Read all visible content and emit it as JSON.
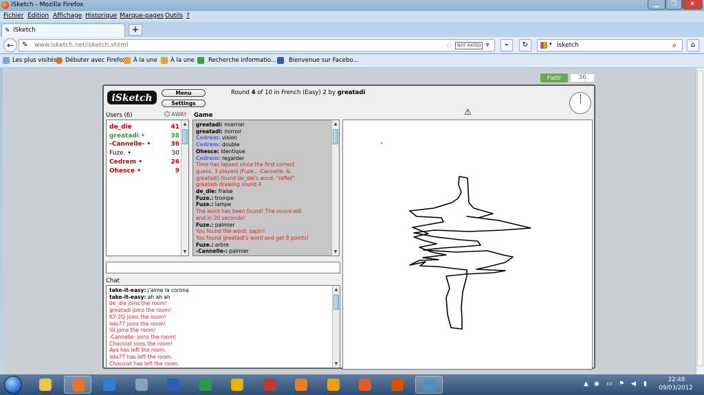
{
  "window": {
    "title": "iSketch - Mozilla Firefox"
  },
  "menu": [
    "Fichier",
    "Édition",
    "Affichage",
    "Historique",
    "Marque-pages",
    "Outils",
    "?"
  ],
  "tab": {
    "label": "iSketch"
  },
  "new_tab": "+",
  "address": {
    "url": "www.isketch.net/isketch.shtml",
    "rating": "NOT RATED"
  },
  "search": {
    "engine_icon": "google-icon",
    "value": "isketch"
  },
  "bookmarks": [
    "Les plus visités",
    "Débuter avec Firefox",
    "À la une",
    "À la une",
    "Recherche informatio...",
    "Bienvenue sur Facebo..."
  ],
  "flattr": {
    "label": "Flattr",
    "count": "36"
  },
  "app": {
    "logo": "iSketch",
    "menu_button": "Menu",
    "settings_button": "Settings",
    "round": {
      "prefix": "Round",
      "current": "4",
      "of": "of",
      "total": "10",
      "mode": "in French (Easy) 2 by",
      "drawer": "greatadi"
    },
    "users_header": "Users (6)",
    "away_label": "AWAY",
    "game_header": "Game",
    "chat_header": "Chat",
    "users": [
      {
        "name": "de_die",
        "score": "41",
        "color": "#cc0000"
      },
      {
        "name": "greatadi •",
        "score": "38",
        "color": "#22aa22"
      },
      {
        "name": "-Cannelle- •",
        "score": "36",
        "color": "#cc0000"
      },
      {
        "name": "Fuze. •",
        "score": "30",
        "color": "#000000"
      },
      {
        "name": "Cedrem •",
        "score": "26",
        "color": "#cc0000"
      },
      {
        "name": "Ohesce •",
        "score": "9",
        "color": "#cc0000"
      }
    ],
    "game_log": [
      {
        "user": "greatadi:",
        "text": " mierroir",
        "color": "#000000",
        "ucolor": "#000000"
      },
      {
        "user": "greatadi:",
        "text": " mirroir",
        "color": "#000000",
        "ucolor": "#000000"
      },
      {
        "user": "Cedrem:",
        "text": " vision",
        "color": "#000000",
        "ucolor": "#5566ee"
      },
      {
        "user": "Cedrem:",
        "text": " double",
        "color": "#000000",
        "ucolor": "#5566ee"
      },
      {
        "user": "Ohesce:",
        "text": " identique",
        "color": "#000000",
        "ucolor": "#000000"
      },
      {
        "user": "Cedrem:",
        "text": " regarder",
        "color": "#000000",
        "ucolor": "#5566ee"
      },
      {
        "user": "",
        "text": "Time has lapsed since the first correct",
        "color": "#dd2222",
        "ucolor": "#dd2222"
      },
      {
        "user": "",
        "text": "guess. 3 players (Fuze., -Cannelle- &",
        "color": "#dd2222",
        "ucolor": "#dd2222"
      },
      {
        "user": "",
        "text": "greatadi) found de_die's word: \"reflet\"",
        "color": "#dd2222",
        "ucolor": "#dd2222"
      },
      {
        "user": "",
        "text": "greatadi drawing round 4",
        "color": "#dd2222",
        "ucolor": "#dd2222"
      },
      {
        "user": "de_die:",
        "text": " fraise",
        "color": "#000000",
        "ucolor": "#000000"
      },
      {
        "user": "Fuze.:",
        "text": " trompe",
        "color": "#000000",
        "ucolor": "#000000"
      },
      {
        "user": "Fuze.:",
        "text": " lampe",
        "color": "#000000",
        "ucolor": "#000000"
      },
      {
        "user": "",
        "text": "The word has been found! The round will",
        "color": "#dd2222",
        "ucolor": "#dd2222"
      },
      {
        "user": "",
        "text": "end in 20 seconds!",
        "color": "#dd2222",
        "ucolor": "#dd2222"
      },
      {
        "user": "Fuze.:",
        "text": " palmier",
        "color": "#000000",
        "ucolor": "#000000"
      },
      {
        "user": "",
        "text": "You found the word: sapin!",
        "color": "#dd2222",
        "ucolor": "#dd2222"
      },
      {
        "user": "",
        "text": "You found greatadi's word and get 8 points!",
        "color": "#dd2222",
        "ucolor": "#dd2222"
      },
      {
        "user": "Fuze.:",
        "text": " arbre",
        "color": "#000000",
        "ucolor": "#000000"
      },
      {
        "user": "-Cannelle-:",
        "text": " palmier",
        "color": "#000000",
        "ucolor": "#000000"
      }
    ],
    "chat_log": [
      {
        "user": "take-it-easy:",
        "text": " j'aime la corona",
        "color": "#000000"
      },
      {
        "user": "take-it-easy:",
        "text": " ah ah ah",
        "color": "#000000"
      },
      {
        "user": "",
        "text": "de_die joins the room!",
        "color": "#dd2222"
      },
      {
        "user": "",
        "text": "greatadi joins the room!",
        "color": "#dd2222"
      },
      {
        "user": "",
        "text": "K7-2Q joins the room!",
        "color": "#dd2222"
      },
      {
        "user": "",
        "text": "lolo77 joins the room!",
        "color": "#dd2222"
      },
      {
        "user": "",
        "text": "lili joins the room!",
        "color": "#dd2222"
      },
      {
        "user": "",
        "text": "-Cannelle- joins the room!",
        "color": "#dd2222"
      },
      {
        "user": "",
        "text": "Chocolat joins the room!",
        "color": "#dd2222"
      },
      {
        "user": "",
        "text": "Aya has left the room.",
        "color": "#dd2222"
      },
      {
        "user": "",
        "text": "lolo77 has left the room.",
        "color": "#dd2222"
      },
      {
        "user": "",
        "text": "Chocolat has left the room.",
        "color": "#dd2222"
      }
    ]
  },
  "taskbar": {
    "apps": [
      "folder-icon",
      "firefox-icon",
      "messenger-icon",
      "calculator-icon",
      "word-icon",
      "excel-icon",
      "headphones-icon",
      "bee-icon",
      "eye-icon",
      "vlc-icon",
      "media-icon",
      "photo-icon",
      "audio-icon"
    ],
    "time": "22:48",
    "date": "09/03/2012"
  }
}
